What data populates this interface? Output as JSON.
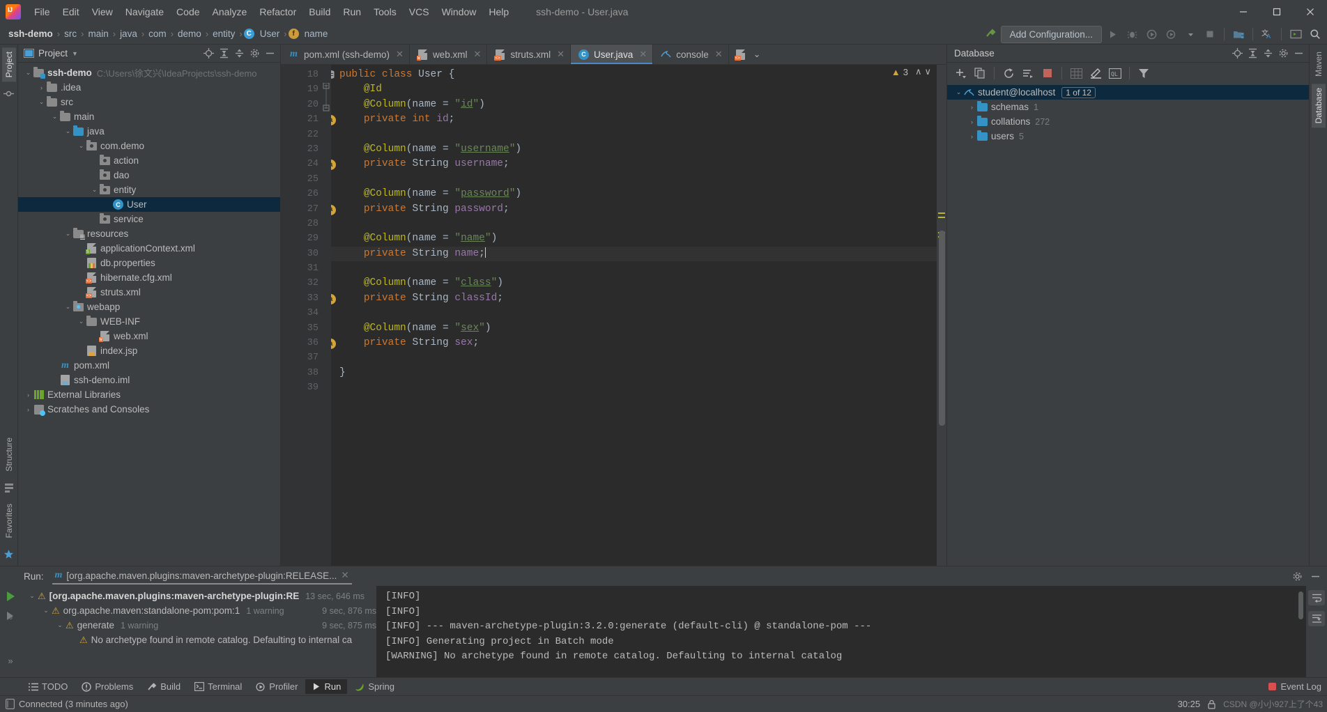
{
  "window": {
    "title": "ssh-demo - User.java",
    "menus": [
      "File",
      "Edit",
      "View",
      "Navigate",
      "Code",
      "Analyze",
      "Refactor",
      "Build",
      "Run",
      "Tools",
      "VCS",
      "Window",
      "Help"
    ],
    "controls": {
      "minimize": "—",
      "maximize": "☐",
      "close": "✕"
    }
  },
  "breadcrumb": {
    "items": [
      "ssh-demo",
      "src",
      "main",
      "java",
      "com",
      "demo",
      "entity",
      "User",
      "name"
    ],
    "class_badge": "C",
    "field_badge": "f"
  },
  "toolbar": {
    "add_configuration": "Add Configuration...",
    "icons": [
      "run-icon",
      "debug-icon",
      "run-with-coverage-icon",
      "profiler-icon",
      "dropdown-icon",
      "stop-icon",
      "project-structure-icon",
      "translate-icon",
      "terminal-icon",
      "search-icon"
    ]
  },
  "left_rail": {
    "top_tabs": [
      "Project"
    ],
    "bottom_tabs": [
      "Structure",
      "Favorites"
    ],
    "icons": [
      "commit-icon",
      "bookmark-icon",
      "persistence-icon"
    ]
  },
  "right_rail": {
    "tabs": [
      "Maven",
      "Database"
    ]
  },
  "project_panel": {
    "title": "Project",
    "header_icons": [
      "locate-icon",
      "expand-all-icon",
      "collapse-all-icon",
      "settings-icon",
      "hide-icon"
    ],
    "tree": [
      {
        "depth": 0,
        "arrow": "⌄",
        "icon": "module-folder-icon",
        "label": "ssh-demo",
        "bold": true,
        "path": "C:\\Users\\徐文兴\\IdeaProjects\\ssh-demo",
        "selected": false
      },
      {
        "depth": 1,
        "arrow": "›",
        "icon": "folder-icon",
        "label": ".idea",
        "selected": false
      },
      {
        "depth": 1,
        "arrow": "⌄",
        "icon": "folder-icon",
        "label": "src",
        "selected": false
      },
      {
        "depth": 2,
        "arrow": "⌄",
        "icon": "folder-icon",
        "label": "main",
        "selected": false
      },
      {
        "depth": 3,
        "arrow": "⌄",
        "icon": "source-folder-icon",
        "label": "java",
        "selected": false
      },
      {
        "depth": 4,
        "arrow": "⌄",
        "icon": "package-icon",
        "label": "com.demo",
        "selected": false
      },
      {
        "depth": 5,
        "arrow": "",
        "icon": "package-icon",
        "label": "action",
        "selected": false
      },
      {
        "depth": 5,
        "arrow": "",
        "icon": "package-icon",
        "label": "dao",
        "selected": false
      },
      {
        "depth": 5,
        "arrow": "⌄",
        "icon": "package-icon",
        "label": "entity",
        "selected": false
      },
      {
        "depth": 6,
        "arrow": "",
        "icon": "java-class-icon",
        "label": "User",
        "selected": true
      },
      {
        "depth": 5,
        "arrow": "",
        "icon": "package-icon",
        "label": "service",
        "selected": false
      },
      {
        "depth": 3,
        "arrow": "⌄",
        "icon": "resource-folder-icon",
        "label": "resources",
        "selected": false
      },
      {
        "depth": 4,
        "arrow": "",
        "icon": "spring-xml-icon",
        "label": "applicationContext.xml",
        "selected": false
      },
      {
        "depth": 4,
        "arrow": "",
        "icon": "properties-icon",
        "label": "db.properties",
        "selected": false
      },
      {
        "depth": 4,
        "arrow": "",
        "icon": "xml-icon",
        "label": "hibernate.cfg.xml",
        "selected": false
      },
      {
        "depth": 4,
        "arrow": "",
        "icon": "xml-icon",
        "label": "struts.xml",
        "selected": false
      },
      {
        "depth": 3,
        "arrow": "⌄",
        "icon": "webapp-folder-icon",
        "label": "webapp",
        "selected": false
      },
      {
        "depth": 4,
        "arrow": "⌄",
        "icon": "folder-icon",
        "label": "WEB-INF",
        "selected": false
      },
      {
        "depth": 5,
        "arrow": "",
        "icon": "web-xml-icon",
        "label": "web.xml",
        "selected": false
      },
      {
        "depth": 4,
        "arrow": "",
        "icon": "jsp-icon",
        "label": "index.jsp",
        "selected": false
      },
      {
        "depth": 2,
        "arrow": "",
        "icon": "maven-icon",
        "label": "pom.xml",
        "selected": false
      },
      {
        "depth": 2,
        "arrow": "",
        "icon": "iml-icon",
        "label": "ssh-demo.iml",
        "selected": false
      },
      {
        "depth": 0,
        "arrow": "›",
        "icon": "libraries-icon",
        "label": "External Libraries",
        "selected": false
      },
      {
        "depth": 0,
        "arrow": "›",
        "icon": "scratches-icon",
        "label": "Scratches and Consoles",
        "selected": false
      }
    ]
  },
  "editor": {
    "tabs": [
      {
        "label": "pom.xml (ssh-demo)",
        "icon": "maven-icon",
        "active": false,
        "closable": true
      },
      {
        "label": "web.xml",
        "icon": "web-xml-icon",
        "active": false,
        "closable": true
      },
      {
        "label": "struts.xml",
        "icon": "xml-icon",
        "active": false,
        "closable": true
      },
      {
        "label": "User.java",
        "icon": "java-class-icon",
        "active": true,
        "closable": true
      },
      {
        "label": "console",
        "icon": "mysql-icon",
        "active": false,
        "closable": true
      }
    ],
    "tab_extra_icons": [
      "xml-icon",
      "chevron-down-icon"
    ],
    "inspection": {
      "warning_count": "3",
      "up": "∧",
      "down": "∨"
    },
    "first_line_number": 18,
    "lines": [
      {
        "n": 18,
        "mark": "db-mapping-icon",
        "tokens": [
          {
            "t": "public ",
            "c": "kw"
          },
          {
            "t": "class ",
            "c": "kw"
          },
          {
            "t": "User ",
            "c": "typ"
          },
          {
            "t": "{",
            "c": "typ"
          }
        ]
      },
      {
        "n": 19,
        "mark": "fold-start-icon",
        "tokens": [
          {
            "t": "    ",
            "c": "typ"
          },
          {
            "t": "@Id",
            "c": "ann"
          }
        ]
      },
      {
        "n": 20,
        "mark": "fold-end-icon",
        "tokens": [
          {
            "t": "    ",
            "c": "typ"
          },
          {
            "t": "@Column",
            "c": "ann"
          },
          {
            "t": "(name = ",
            "c": "typ"
          },
          {
            "t": "\"",
            "c": "strq"
          },
          {
            "t": "id",
            "c": "str"
          },
          {
            "t": "\"",
            "c": "strq"
          },
          {
            "t": ")",
            "c": "typ"
          }
        ]
      },
      {
        "n": 21,
        "mark": "annotation-key-icon",
        "tokens": [
          {
            "t": "    ",
            "c": "typ"
          },
          {
            "t": "private ",
            "c": "kw"
          },
          {
            "t": "int ",
            "c": "kw"
          },
          {
            "t": "id",
            "c": "fld"
          },
          {
            "t": ";",
            "c": "typ"
          }
        ]
      },
      {
        "n": 22,
        "mark": "",
        "tokens": []
      },
      {
        "n": 23,
        "mark": "",
        "tokens": [
          {
            "t": "    ",
            "c": "typ"
          },
          {
            "t": "@Column",
            "c": "ann"
          },
          {
            "t": "(name = ",
            "c": "typ"
          },
          {
            "t": "\"",
            "c": "strq"
          },
          {
            "t": "username",
            "c": "str"
          },
          {
            "t": "\"",
            "c": "strq"
          },
          {
            "t": ")",
            "c": "typ"
          }
        ]
      },
      {
        "n": 24,
        "mark": "annotation-icon",
        "tokens": [
          {
            "t": "    ",
            "c": "typ"
          },
          {
            "t": "private ",
            "c": "kw"
          },
          {
            "t": "String ",
            "c": "typ"
          },
          {
            "t": "username",
            "c": "fld"
          },
          {
            "t": ";",
            "c": "typ"
          }
        ]
      },
      {
        "n": 25,
        "mark": "",
        "tokens": []
      },
      {
        "n": 26,
        "mark": "",
        "tokens": [
          {
            "t": "    ",
            "c": "typ"
          },
          {
            "t": "@Column",
            "c": "ann"
          },
          {
            "t": "(name = ",
            "c": "typ"
          },
          {
            "t": "\"",
            "c": "strq"
          },
          {
            "t": "password",
            "c": "str"
          },
          {
            "t": "\"",
            "c": "strq"
          },
          {
            "t": ")",
            "c": "typ"
          }
        ]
      },
      {
        "n": 27,
        "mark": "annotation-icon",
        "tokens": [
          {
            "t": "    ",
            "c": "typ"
          },
          {
            "t": "private ",
            "c": "kw"
          },
          {
            "t": "String ",
            "c": "typ"
          },
          {
            "t": "password",
            "c": "fld"
          },
          {
            "t": ";",
            "c": "typ"
          }
        ]
      },
      {
        "n": 28,
        "mark": "",
        "tokens": []
      },
      {
        "n": 29,
        "mark": "",
        "tokens": [
          {
            "t": "    ",
            "c": "typ"
          },
          {
            "t": "@Column",
            "c": "ann"
          },
          {
            "t": "(name = ",
            "c": "typ"
          },
          {
            "t": "\"",
            "c": "strq"
          },
          {
            "t": "name",
            "c": "str"
          },
          {
            "t": "\"",
            "c": "strq"
          },
          {
            "t": ")",
            "c": "typ"
          }
        ]
      },
      {
        "n": 30,
        "mark": "annotation-icon",
        "current": true,
        "caret": true,
        "tokens": [
          {
            "t": "    ",
            "c": "typ"
          },
          {
            "t": "private ",
            "c": "kw"
          },
          {
            "t": "String ",
            "c": "typ"
          },
          {
            "t": "name",
            "c": "fld"
          },
          {
            "t": ";",
            "c": "typ"
          }
        ]
      },
      {
        "n": 31,
        "mark": "",
        "tokens": []
      },
      {
        "n": 32,
        "mark": "",
        "tokens": [
          {
            "t": "    ",
            "c": "typ"
          },
          {
            "t": "@Column",
            "c": "ann"
          },
          {
            "t": "(name = ",
            "c": "typ"
          },
          {
            "t": "\"",
            "c": "strq"
          },
          {
            "t": "class",
            "c": "str"
          },
          {
            "t": "\"",
            "c": "strq"
          },
          {
            "t": ")",
            "c": "typ"
          }
        ]
      },
      {
        "n": 33,
        "mark": "annotation-icon",
        "tokens": [
          {
            "t": "    ",
            "c": "typ"
          },
          {
            "t": "private ",
            "c": "kw"
          },
          {
            "t": "String ",
            "c": "typ"
          },
          {
            "t": "classId",
            "c": "fld"
          },
          {
            "t": ";",
            "c": "typ"
          }
        ]
      },
      {
        "n": 34,
        "mark": "",
        "tokens": []
      },
      {
        "n": 35,
        "mark": "",
        "tokens": [
          {
            "t": "    ",
            "c": "typ"
          },
          {
            "t": "@Column",
            "c": "ann"
          },
          {
            "t": "(name = ",
            "c": "typ"
          },
          {
            "t": "\"",
            "c": "strq"
          },
          {
            "t": "sex",
            "c": "str"
          },
          {
            "t": "\"",
            "c": "strq"
          },
          {
            "t": ")",
            "c": "typ"
          }
        ]
      },
      {
        "n": 36,
        "mark": "annotation-icon",
        "tokens": [
          {
            "t": "    ",
            "c": "typ"
          },
          {
            "t": "private ",
            "c": "kw"
          },
          {
            "t": "String ",
            "c": "typ"
          },
          {
            "t": "sex",
            "c": "fld"
          },
          {
            "t": ";",
            "c": "typ"
          }
        ]
      },
      {
        "n": 37,
        "mark": "",
        "tokens": []
      },
      {
        "n": 38,
        "mark": "",
        "tokens": [
          {
            "t": "}",
            "c": "typ"
          }
        ]
      },
      {
        "n": 39,
        "mark": "",
        "tokens": []
      }
    ]
  },
  "database_panel": {
    "title": "Database",
    "toolbar_icons": [
      "add-icon",
      "duplicate-icon",
      "refresh-icon",
      "sync-icon",
      "stop-icon",
      "table-icon",
      "edit-icon",
      "query-console-icon",
      "filter-icon"
    ],
    "header_icons": [
      "locate-icon",
      "expand-all-icon",
      "collapse-all-icon",
      "settings-icon",
      "hide-icon"
    ],
    "tree": [
      {
        "depth": 0,
        "arrow": "⌄",
        "icon": "mysql-icon",
        "label": "student@localhost",
        "pill": "1 of 12",
        "selected": true
      },
      {
        "depth": 1,
        "arrow": "›",
        "icon": "folder-icon",
        "label": "schemas",
        "count": "1",
        "selected": false
      },
      {
        "depth": 1,
        "arrow": "›",
        "icon": "folder-icon",
        "label": "collations",
        "count": "272",
        "selected": false
      },
      {
        "depth": 1,
        "arrow": "›",
        "icon": "folder-icon",
        "label": "users",
        "count": "5",
        "selected": false
      }
    ]
  },
  "run_panel": {
    "label": "Run:",
    "tab": "[org.apache.maven.plugins:maven-archetype-plugin:RELEASE...",
    "tab_icon": "maven-icon",
    "header_icons": [
      "settings-icon",
      "hide-icon"
    ],
    "side_icons": [
      "rerun-icon",
      "debug-rerun-icon",
      "expand-icon"
    ],
    "tree": [
      {
        "depth": 0,
        "arrow": "⌄",
        "label": "[org.apache.maven.plugins:maven-archetype-plugin:RE",
        "bold": true,
        "dim": "13 sec, 646 ms",
        "warn": true
      },
      {
        "depth": 1,
        "arrow": "⌄",
        "label": "org.apache.maven:standalone-pom:pom:1",
        "dim": "1 warning",
        "dim2": "9 sec, 876 ms",
        "warn": true
      },
      {
        "depth": 2,
        "arrow": "⌄",
        "label": "generate",
        "dim": "1 warning",
        "dim2": "9 sec, 875 ms",
        "warn": true
      },
      {
        "depth": 3,
        "arrow": "",
        "label": "No archetype found in remote catalog. Defaulting to internal ca",
        "warn": true
      }
    ],
    "console": [
      "[INFO]",
      "[INFO] --- maven-archetype-plugin:3.2.0:generate (default-cli) @ standalone-pom ---",
      "[INFO] Generating project in Batch mode",
      "[WARNING] No archetype found in remote catalog. Defaulting to internal catalog"
    ],
    "right_icons": [
      "wrap-text-icon",
      "scroll-end-icon"
    ]
  },
  "bottom_toolwindows": {
    "items": [
      {
        "label": "TODO",
        "icon": "todo-icon",
        "active": false
      },
      {
        "label": "Problems",
        "icon": "problems-icon",
        "active": false
      },
      {
        "label": "Build",
        "icon": "build-icon",
        "active": false
      },
      {
        "label": "Terminal",
        "icon": "terminal-icon",
        "active": false
      },
      {
        "label": "Profiler",
        "icon": "profiler-icon",
        "active": false
      },
      {
        "label": "Run",
        "icon": "run-icon",
        "active": true
      },
      {
        "label": "Spring",
        "icon": "spring-icon",
        "active": false
      }
    ],
    "event_log": {
      "label": "Event Log",
      "icon": "event-log-icon"
    }
  },
  "statusbar": {
    "connected": "Connected (3 minutes ago)",
    "caret_position": "30:25",
    "watermark": "CSDN @小小927上了个43",
    "icons": [
      "db-status-icon",
      "lock-icon",
      "notifications-icon"
    ]
  },
  "colors": {
    "accent_blue": "#3592c4",
    "selection": "#0d293e",
    "warning": "#d6a434",
    "editor_bg": "#2b2b2b",
    "panel_bg": "#3c3f41",
    "string": "#6a8759",
    "keyword": "#cc7832",
    "annotation": "#bbb529",
    "field": "#9876aa"
  }
}
